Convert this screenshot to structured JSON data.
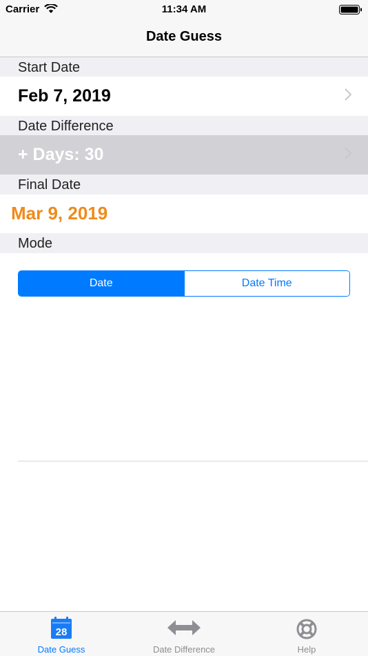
{
  "status_bar": {
    "carrier": "Carrier",
    "time": "11:34 AM"
  },
  "nav": {
    "title": "Date Guess"
  },
  "sections": {
    "start_date": {
      "header": "Start Date",
      "value": "Feb 7, 2019"
    },
    "date_difference": {
      "header": "Date Difference",
      "value": "+ Days: 30"
    },
    "final_date": {
      "header": "Final Date",
      "value": "Mar 9, 2019"
    },
    "mode": {
      "header": "Mode",
      "options": [
        "Date",
        "Date Time"
      ],
      "selected": "Date"
    }
  },
  "tabs": [
    {
      "label": "Date Guess",
      "icon": "calendar-icon",
      "icon_text": "28",
      "selected": true
    },
    {
      "label": "Date Difference",
      "icon": "double-arrow-icon",
      "selected": false
    },
    {
      "label": "Help",
      "icon": "lifebuoy-icon",
      "selected": false
    }
  ],
  "colors": {
    "accent": "#007aff",
    "final_date": "#ef8a1a",
    "section_header_bg": "#efeff4",
    "highlighted_row_bg": "#d1d1d6"
  }
}
